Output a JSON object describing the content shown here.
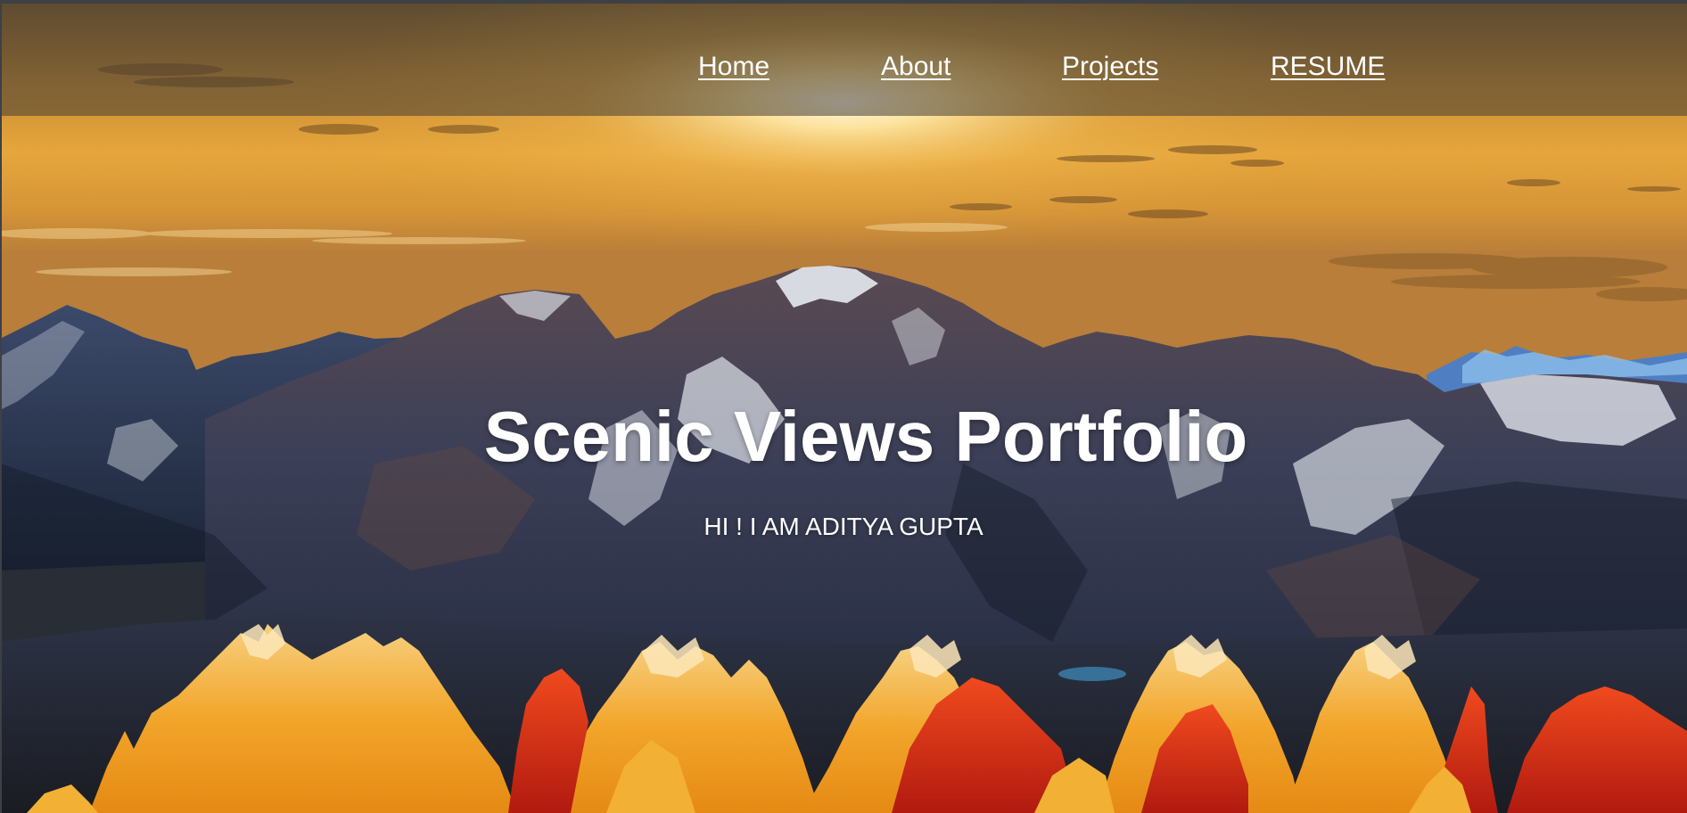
{
  "nav": {
    "home": "Home",
    "about": "About",
    "projects": "Projects",
    "resume": "RESUME"
  },
  "hero": {
    "title": "Scenic Views Portfolio",
    "subtitle": "HI ! I AM ADITYA GUPTA"
  },
  "colors": {
    "sky_gold": "#e8a83a",
    "sky_light": "#fff1c2",
    "mountain_dark": "#2a3550",
    "snow": "#e9edf3",
    "foliage_gold": "#f0a321",
    "foliage_red": "#d8281a",
    "nav_overlay": "#463e34"
  }
}
